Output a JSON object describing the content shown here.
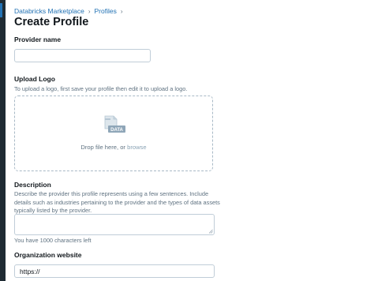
{
  "breadcrumb": {
    "items": [
      "Databricks Marketplace",
      "Profiles"
    ],
    "separator": "›"
  },
  "page": {
    "title": "Create Profile"
  },
  "provider_name": {
    "label": "Provider name",
    "value": "",
    "placeholder": ""
  },
  "upload_logo": {
    "label": "Upload Logo",
    "help": "To upload a logo, first save your profile then edit it to upload a logo.",
    "drop_text": "Drop file here, or",
    "browse_label": "browse",
    "icon": "file-data-upload-icon",
    "icon_badge": "DATA"
  },
  "description": {
    "label": "Description",
    "help": "Describe the provider this profile represents using a few sentences. Include details such as industries pertaining to the provider and the types of data assets typically listed by the provider.",
    "value": "",
    "char_count": "You have 1000 characters left"
  },
  "website": {
    "label": "Organization website",
    "value": "https://"
  },
  "colors": {
    "link": "#2272b4",
    "text": "#11171c",
    "muted": "#5f7281",
    "border": "#c0cdd8",
    "rail": "#1f2b33"
  }
}
